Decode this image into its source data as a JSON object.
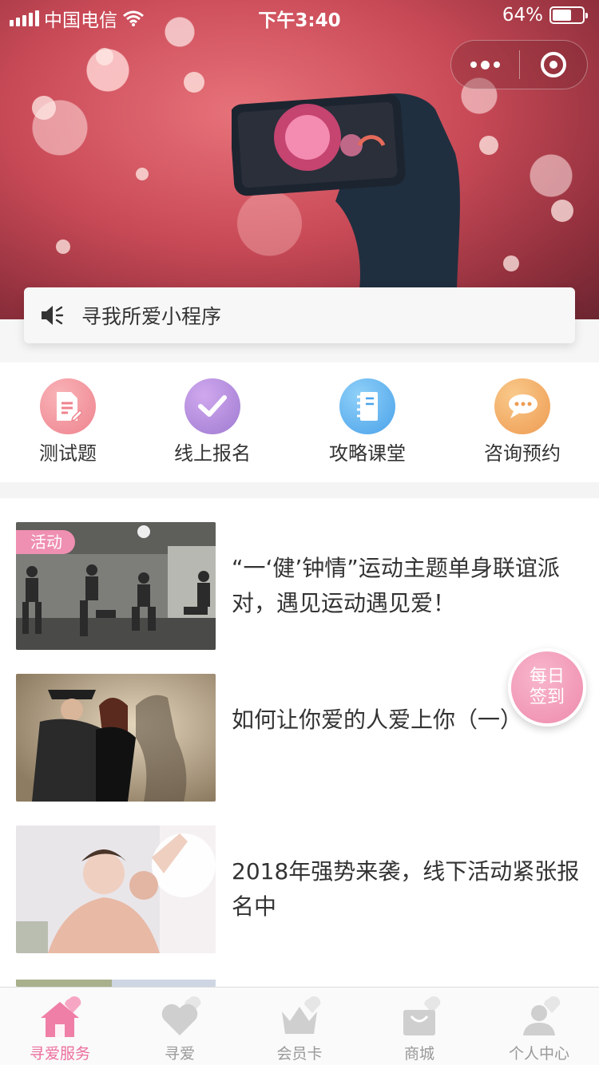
{
  "status_bar": {
    "carrier": "中国电信",
    "time": "下午3:40",
    "battery": "64%",
    "battery_level": 0.64
  },
  "capsule": {
    "more_icon": "more-dots-icon",
    "close_icon": "target-circle-icon"
  },
  "notice": {
    "icon": "speaker-icon",
    "text": "寻我所爱小程序"
  },
  "quick_menu": [
    {
      "label": "测试题",
      "icon": "document-edit-icon",
      "color": "#f08a97"
    },
    {
      "label": "线上报名",
      "icon": "checkmark-icon",
      "color": "#b08ad8"
    },
    {
      "label": "攻略课堂",
      "icon": "notebook-icon",
      "color": "#5fb5f0"
    },
    {
      "label": "咨询预约",
      "icon": "chat-bubbles-icon",
      "color": "#f1a85c"
    }
  ],
  "articles": [
    {
      "tag": "活动",
      "title": "“一‘健’钟情”运动主题单身联谊派对，遇见运动遇见爱！"
    },
    {
      "tag": "",
      "title": "如何让你爱的人爱上你（一）"
    },
    {
      "tag": "",
      "title": "2018年强势来袭，线下活动紧张报名中"
    }
  ],
  "signin": {
    "line1": "每日",
    "line2": "签到"
  },
  "tabbar": [
    {
      "label": "寻爱服务",
      "icon": "home-heart-icon",
      "active": true
    },
    {
      "label": "寻爱",
      "icon": "heart-icon",
      "active": false
    },
    {
      "label": "会员卡",
      "icon": "crown-icon",
      "active": false
    },
    {
      "label": "商城",
      "icon": "shopping-bag-icon",
      "active": false
    },
    {
      "label": "个人中心",
      "icon": "user-icon",
      "active": false
    }
  ]
}
